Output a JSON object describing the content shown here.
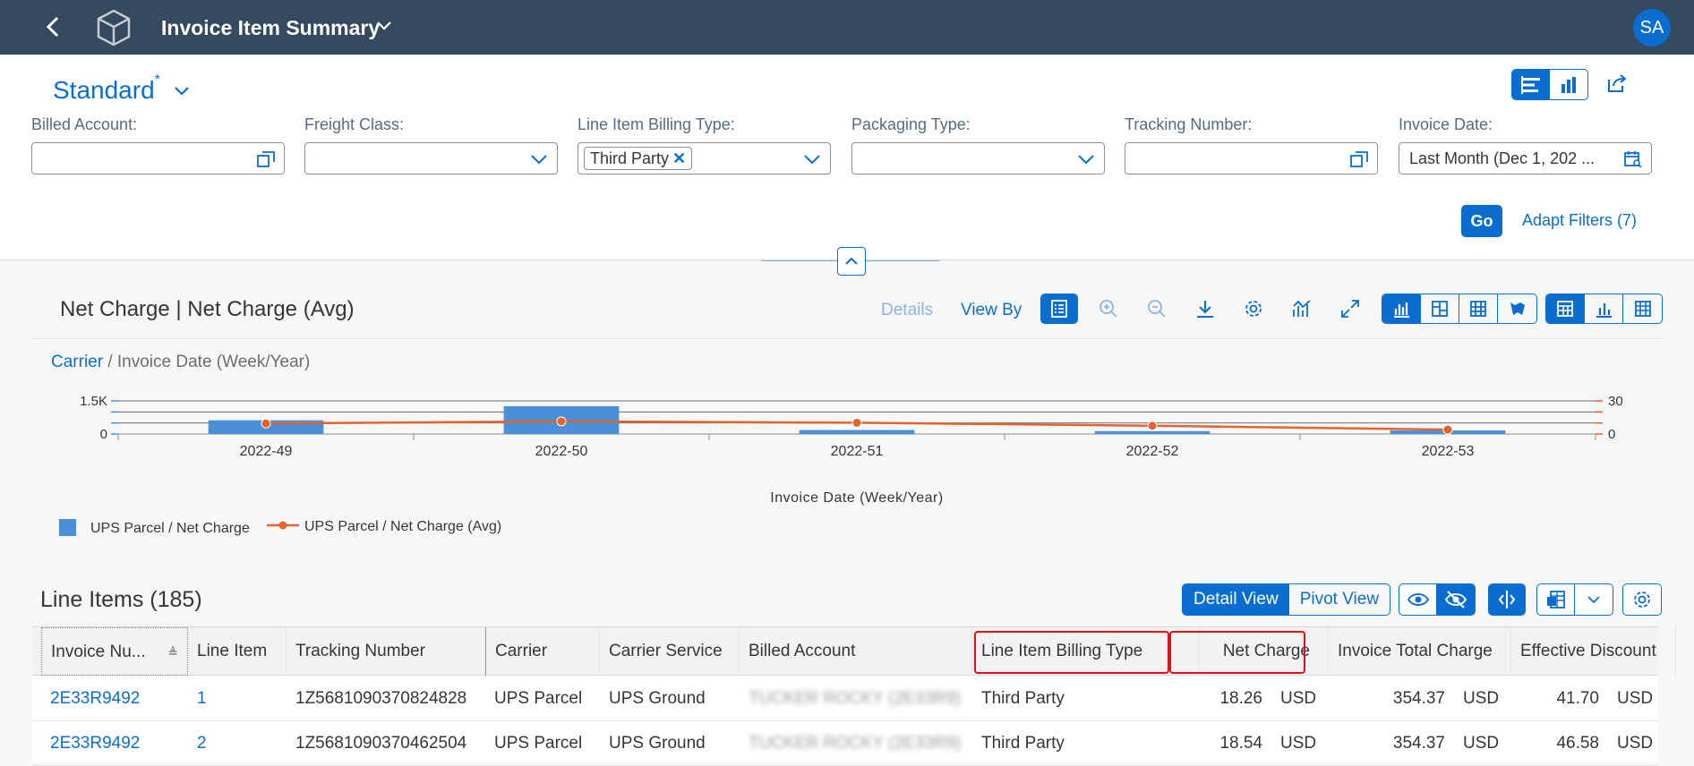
{
  "shell": {
    "title": "Invoice Item Summary",
    "avatar": "SA"
  },
  "variant": {
    "name": "Standard",
    "modified_marker": "*"
  },
  "filters": [
    {
      "label": "Billed Account:",
      "value": "",
      "icon": "value-help-icon"
    },
    {
      "label": "Freight Class:",
      "value": "",
      "icon": "chevron-down-icon"
    },
    {
      "label": "Line Item Billing Type:",
      "token": "Third Party",
      "icon": "chevron-down-icon"
    },
    {
      "label": "Packaging Type:",
      "value": "",
      "icon": "chevron-down-icon"
    },
    {
      "label": "Tracking Number:",
      "value": "",
      "icon": "value-help-icon"
    },
    {
      "label": "Invoice Date:",
      "value": "Last Month (Dec 1, 202 ...",
      "icon": "calendar-search-icon"
    }
  ],
  "filterbar": {
    "go": "Go",
    "adapt": "Adapt Filters (7)"
  },
  "chart_card": {
    "title": "Net Charge | Net Charge (Avg)",
    "details": "Details",
    "view_by": "View By",
    "breadcrumb_link": "Carrier",
    "breadcrumb_rest": " / Invoice Date (Week/Year)"
  },
  "chart_data": {
    "type": "bar",
    "categories": [
      "2022-49",
      "2022-50",
      "2022-51",
      "2022-52",
      "2022-53"
    ],
    "series": [
      {
        "name": "UPS Parcel / Net Charge",
        "type": "bar",
        "axis": "left",
        "color": "#4a90d9",
        "values": [
          620,
          1260,
          180,
          130,
          160
        ]
      },
      {
        "name": "UPS Parcel / Net Charge (Avg)",
        "type": "line",
        "axis": "right",
        "color": "#e3632a",
        "values": [
          9.5,
          11.5,
          10.2,
          7.5,
          4
        ]
      }
    ],
    "xlabel": "Invoice Date (Week/Year)",
    "ylim_left": [
      0,
      1500
    ],
    "ylim_right": [
      0,
      30
    ],
    "yticks_left": [
      "0",
      "1.5K"
    ],
    "yticks_right": [
      "0",
      "30"
    ],
    "legend_position": "bottom-left"
  },
  "table": {
    "title": "Line Items (185)",
    "view_detail": "Detail View",
    "view_pivot": "Pivot View",
    "columns": [
      "Invoice Nu...",
      "Line Item",
      "Tracking Number",
      "Carrier",
      "Carrier Service",
      "Billed Account",
      "Line Item Billing Type",
      "Net Charge",
      "Invoice Total Charge",
      "Effective Discount"
    ],
    "rows": [
      {
        "invoice": "2E33R9492",
        "line": "1",
        "tracking": "1Z5681090370824828",
        "carrier": "UPS Parcel",
        "service": "UPS Ground",
        "account": "TUCKER ROCKY (2E33R9)",
        "billing_type": "Third Party",
        "net": "18.26",
        "net_cur": "USD",
        "total": "354.37",
        "total_cur": "USD",
        "discount": "41.70",
        "discount_cur": "USD"
      },
      {
        "invoice": "2E33R9492",
        "line": "2",
        "tracking": "1Z5681090370462504",
        "carrier": "UPS Parcel",
        "service": "UPS Ground",
        "account": "TUCKER ROCKY (2E33R9)",
        "billing_type": "Third Party",
        "net": "18.54",
        "net_cur": "USD",
        "total": "354.37",
        "total_cur": "USD",
        "discount": "46.58",
        "discount_cur": "USD"
      }
    ]
  }
}
